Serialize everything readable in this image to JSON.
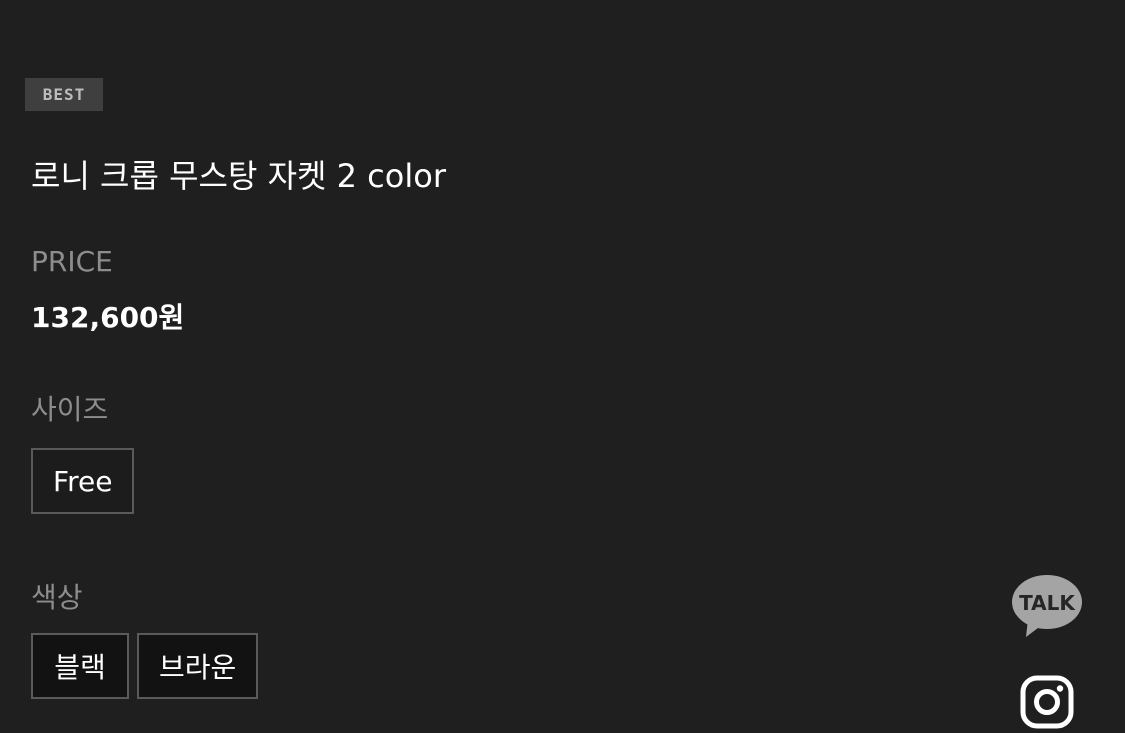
{
  "badge": {
    "label": "BEST"
  },
  "product": {
    "title": "로니 크롭 무스탕 자켓 2 color",
    "price_label": "PRICE",
    "price_value": "132,600원"
  },
  "options": {
    "size": {
      "label": "사이즈",
      "values": [
        "Free"
      ]
    },
    "color": {
      "label": "색상",
      "values": [
        "블랙",
        "브라운"
      ]
    }
  },
  "floating": {
    "talk_label": "TALK",
    "talk_icon": "kakao-talk-icon",
    "instagram_icon": "instagram-icon"
  },
  "colors": {
    "background": "#1f1f1f",
    "badge_bg": "#3f3f3f",
    "muted_text": "#8d8d8d",
    "button_border": "#5a5a5a",
    "talk_bubble": "#a4a4a4"
  }
}
